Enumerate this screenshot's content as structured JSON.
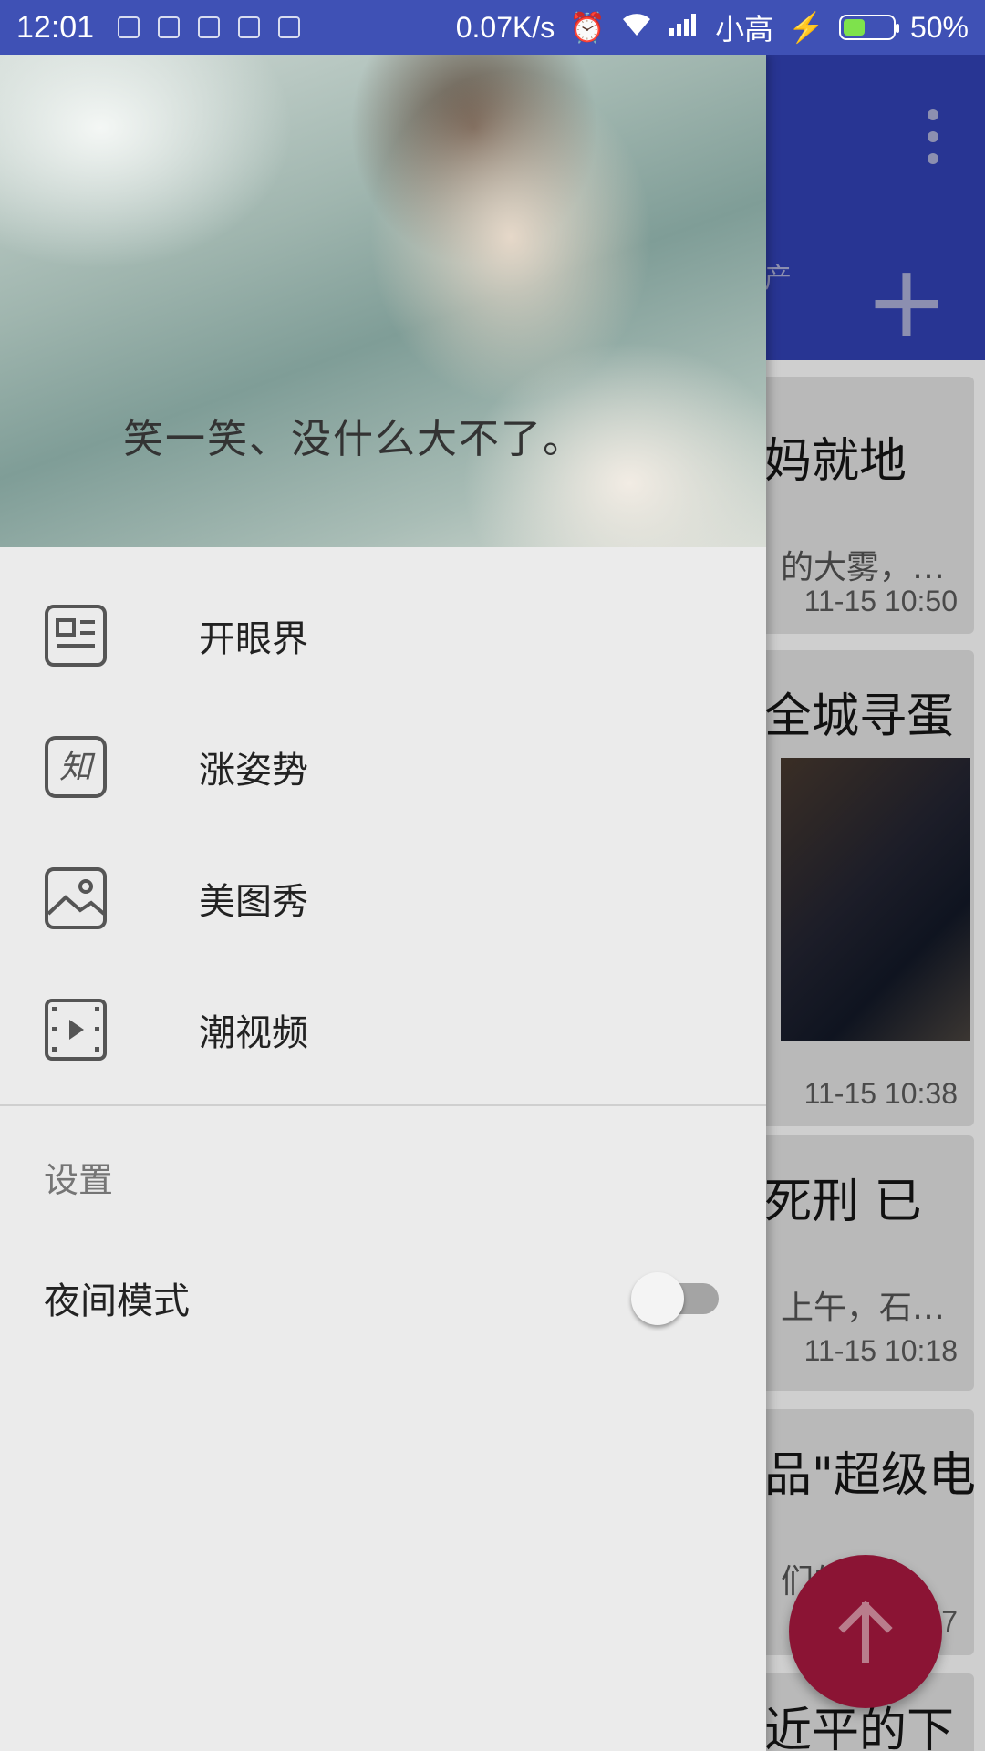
{
  "status_bar": {
    "time": "12:01",
    "net_speed": "0.07K/s",
    "carrier": "小高",
    "battery": "50%",
    "battery_level": 0.5
  },
  "app": {
    "channel_fragment": "产",
    "more_icon": "more-vert-icon",
    "add_icon": "plus-icon",
    "feed": [
      {
        "title_fragment": "妈就地",
        "summary_fragment": "的大雾，…",
        "time": "11-15 10:50"
      },
      {
        "title_fragment": "全城寻蛋",
        "has_image": true,
        "time": "11-15 10:38"
      },
      {
        "title_fragment": "死刑 已",
        "summary_fragment": "上午，石…",
        "time": "11-15 10:18"
      },
      {
        "title_fragment": "品\"超级电",
        "summary_fragment": "们的",
        "time": "7"
      },
      {
        "title_fragment": "近平的下"
      }
    ],
    "fab_icon": "arrow-up-icon"
  },
  "drawer": {
    "header_caption": "笑一笑、没什么大不了。",
    "menu": [
      {
        "label": "开眼界",
        "icon": "news-icon"
      },
      {
        "label": "涨姿势",
        "icon": "zhihu-icon"
      },
      {
        "label": "美图秀",
        "icon": "image-icon"
      },
      {
        "label": "潮视频",
        "icon": "video-icon"
      }
    ],
    "settings_title": "设置",
    "night_mode": {
      "label": "夜间模式",
      "enabled": false
    }
  }
}
